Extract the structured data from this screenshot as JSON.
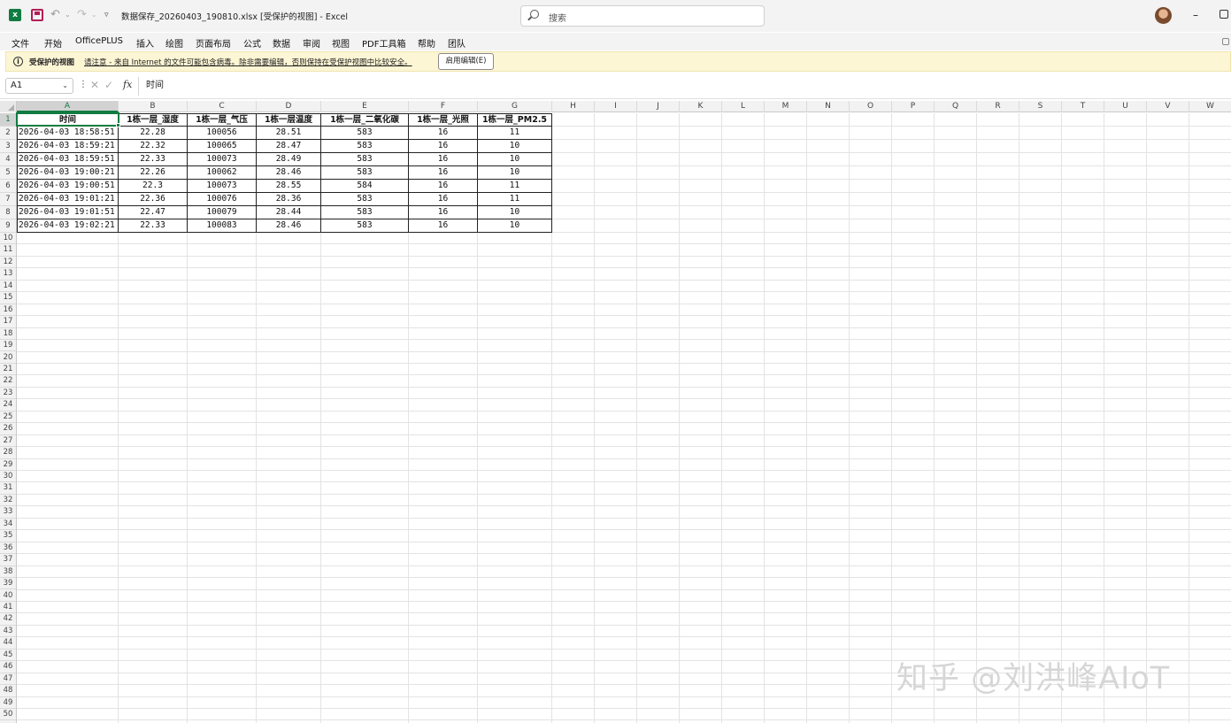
{
  "titlebar": {
    "app_icon": "excel-icon",
    "doc_title": "数据保存_20260403_190810.xlsx  [受保护的视图]  -  Excel",
    "search_placeholder": "搜索",
    "window_controls": [
      "minimize",
      "restore"
    ]
  },
  "menu": {
    "items": [
      "文件",
      "开始",
      "OfficePLUS",
      "插入",
      "绘图",
      "页面布局",
      "公式",
      "数据",
      "审阅",
      "视图",
      "PDF工具箱",
      "帮助",
      "团队"
    ]
  },
  "protected_view": {
    "title": "受保护的视图",
    "message": "请注意 - 来自 Internet 的文件可能包含病毒。除非需要编辑，否则保持在受保护视图中比较安全。",
    "button_label": "启用编辑(E)"
  },
  "formula_bar": {
    "name_box": "A1",
    "fx": "fx",
    "content": "时间"
  },
  "sheet": {
    "columns": [
      "A",
      "B",
      "C",
      "D",
      "E",
      "F",
      "G",
      "H",
      "I",
      "J",
      "K",
      "L",
      "M",
      "N",
      "O",
      "P",
      "Q",
      "R",
      "S",
      "T",
      "U",
      "V",
      "W"
    ],
    "headers": [
      "时间",
      "1栋一层_湿度",
      "1栋一层_气压",
      "1栋一层温度",
      "1栋一层_二氧化碳",
      "1栋一层_光照",
      "1栋一层_PM2.5"
    ],
    "rows": [
      [
        "2026-04-03 18:58:51",
        "22.28",
        "100056",
        "28.51",
        "583",
        "16",
        "11"
      ],
      [
        "2026-04-03 18:59:21",
        "22.32",
        "100065",
        "28.47",
        "583",
        "16",
        "10"
      ],
      [
        "2026-04-03 18:59:51",
        "22.33",
        "100073",
        "28.49",
        "583",
        "16",
        "10"
      ],
      [
        "2026-04-03 19:00:21",
        "22.26",
        "100062",
        "28.46",
        "583",
        "16",
        "10"
      ],
      [
        "2026-04-03 19:00:51",
        "22.3",
        "100073",
        "28.55",
        "584",
        "16",
        "11"
      ],
      [
        "2026-04-03 19:01:21",
        "22.36",
        "100076",
        "28.36",
        "583",
        "16",
        "11"
      ],
      [
        "2026-04-03 19:01:51",
        "22.47",
        "100079",
        "28.44",
        "583",
        "16",
        "10"
      ],
      [
        "2026-04-03 19:02:21",
        "22.33",
        "100083",
        "28.46",
        "583",
        "16",
        "10"
      ]
    ],
    "row_count": 50,
    "selected_cell": "A1"
  },
  "watermark": "知乎 @刘洪峰AIoT"
}
